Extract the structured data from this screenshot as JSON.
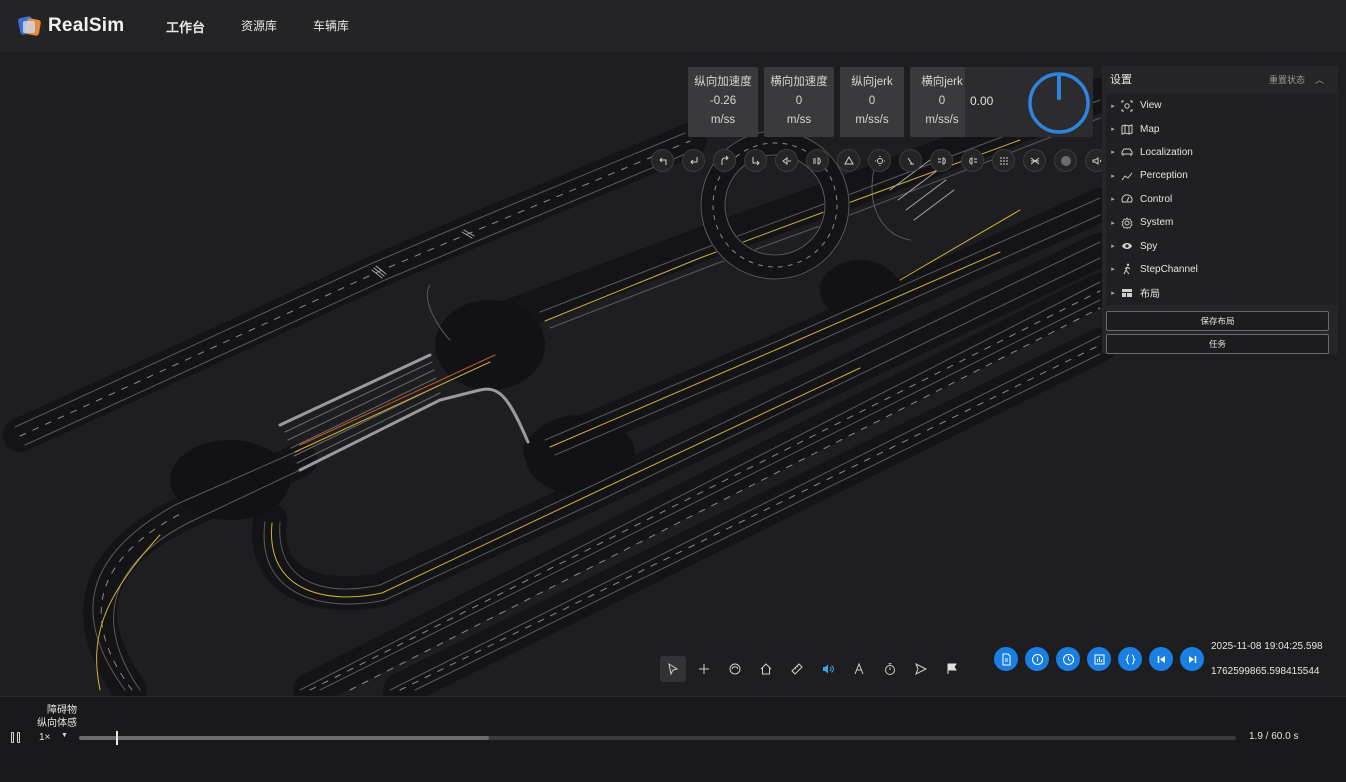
{
  "header": {
    "app_name": "RealSim",
    "nav": [
      "工作台",
      "资源库",
      "车辆库"
    ]
  },
  "gauges": [
    {
      "label": "纵向加速度",
      "value": "-0.26",
      "unit": "m/ss"
    },
    {
      "label": "横向加速度",
      "value": "0",
      "unit": "m/ss"
    },
    {
      "label": "纵向jerk",
      "value": "0",
      "unit": "m/ss/s"
    },
    {
      "label": "横向jerk",
      "value": "0",
      "unit": "m/ss/s"
    }
  ],
  "speed": {
    "value": "0.00",
    "dial_level": 0
  },
  "round_icons": [
    "turn-left-icon",
    "u-turn-left-icon",
    "u-turn-right-icon",
    "turn-right-icon",
    "horn-icon",
    "headlight-icon",
    "hazard-icon",
    "light-icon",
    "wiper-icon",
    "fog-front-icon",
    "fog-rear-icon",
    "lane-change-left-icon",
    "lane-change-right-icon",
    "record-icon",
    "volume-icon"
  ],
  "settings": {
    "title": "设置",
    "reset": "重置状态",
    "items": [
      {
        "label": "View",
        "icon": "view-icon"
      },
      {
        "label": "Map",
        "icon": "map-icon"
      },
      {
        "label": "Localization",
        "icon": "car-icon"
      },
      {
        "label": "Perception",
        "icon": "chart-line-icon"
      },
      {
        "label": "Control",
        "icon": "speedometer-icon"
      },
      {
        "label": "System",
        "icon": "gear-icon"
      },
      {
        "label": "Spy",
        "icon": "eye-icon"
      },
      {
        "label": "StepChannel",
        "icon": "walking-icon"
      },
      {
        "label": "布局",
        "icon": "layout-icon"
      }
    ],
    "save_layout": "保存布局",
    "task": "任务"
  },
  "tools": [
    "pointer-icon",
    "plus-icon",
    "path-icon",
    "home-icon",
    "ruler-icon",
    "sound-icon",
    "text-icon",
    "timer-icon",
    "send-icon",
    "flag-icon"
  ],
  "blue_buttons": [
    "document-icon",
    "info-icon",
    "clock-icon",
    "bar-chart-icon",
    "braces-icon",
    "skip-back-icon",
    "skip-forward-icon"
  ],
  "timestamp": {
    "datetime": "2025-11-08 19:04:25.598",
    "epoch": "1762599865.598415544"
  },
  "playback": {
    "label_1": "障碍物",
    "label_2": "纵向体感",
    "rate": "1×",
    "time": "1.9 / 60.0 s",
    "position": 0.032,
    "buffered": 0.354
  },
  "colors": {
    "accent": "#1a7fe3",
    "dial": "#2f84e0",
    "lane_yellow": "#c8b43a"
  }
}
